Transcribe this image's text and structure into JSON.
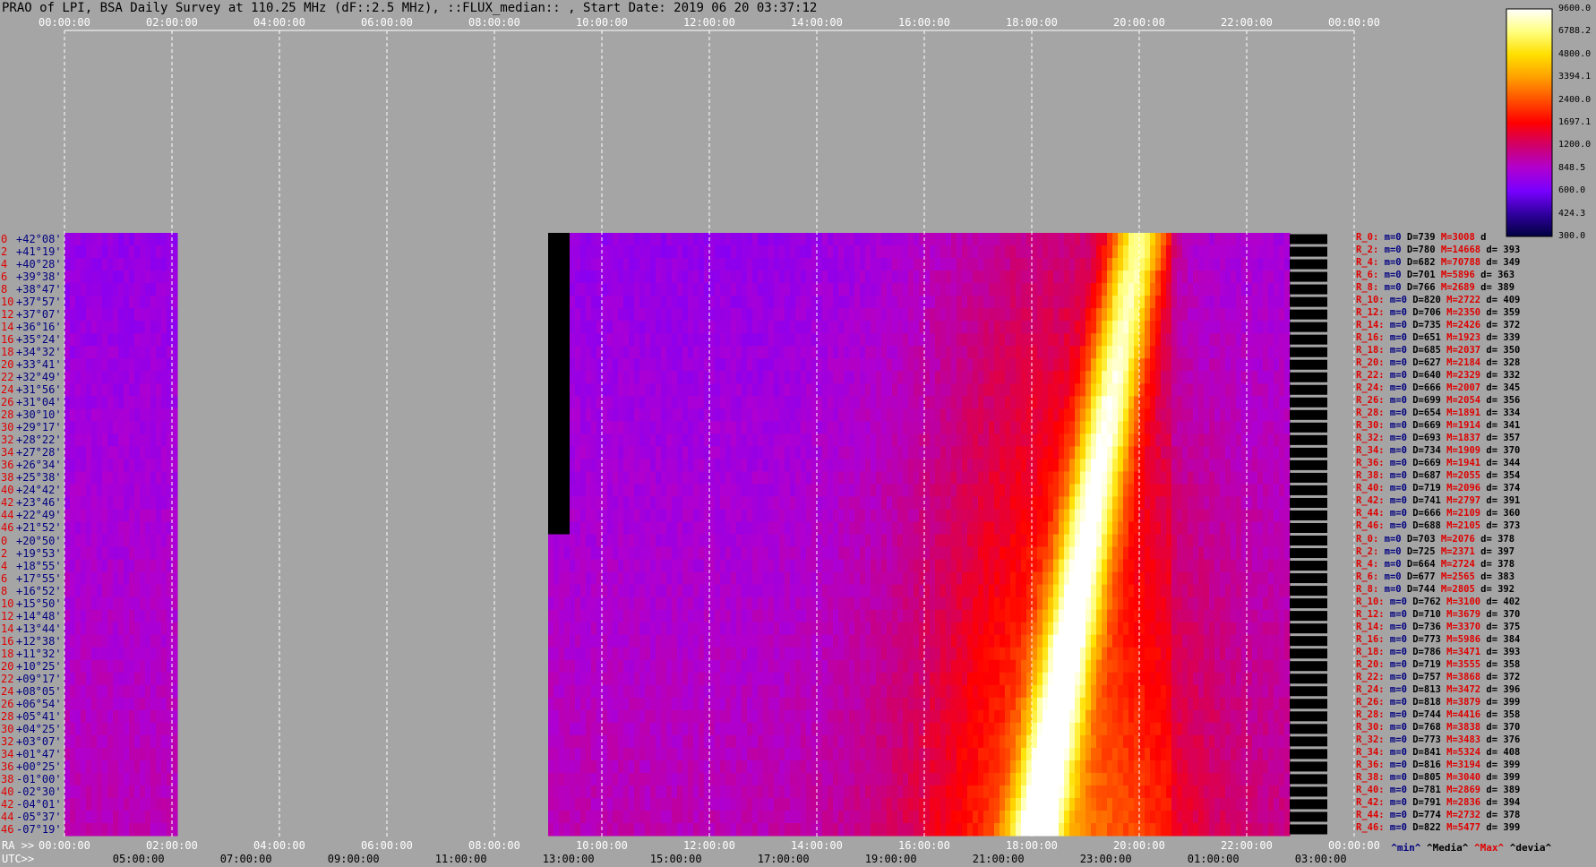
{
  "title": "PRAO of LPI, BSA Daily Survey at 110.25 MHz (dF::2.5 MHz), ::FLUX_median:: , Start Date: 2019 06 20 03:37:12",
  "top_ticks": [
    "00:00:00",
    "02:00:00",
    "04:00:00",
    "06:00:00",
    "08:00:00",
    "10:00:00",
    "12:00:00",
    "14:00:00",
    "16:00:00",
    "18:00:00",
    "20:00:00",
    "22:00:00",
    "00:00:00"
  ],
  "ra_label": "RA >>",
  "ra_ticks": [
    "00:00:00",
    "02:00:00",
    "04:00:00",
    "06:00:00",
    "08:00:00",
    "10:00:00",
    "12:00:00",
    "14:00:00",
    "16:00:00",
    "18:00:00",
    "20:00:00",
    "22:00:00",
    "00:00:00"
  ],
  "utc_label": "UTC>>",
  "utc_ticks": [
    "05:00:00",
    "07:00:00",
    "09:00:00",
    "11:00:00",
    "13:00:00",
    "15:00:00",
    "17:00:00",
    "19:00:00",
    "21:00:00",
    "23:00:00",
    "01:00:00",
    "03:00:00"
  ],
  "colorbar": {
    "labels": [
      "9600.0",
      "6788.2",
      "4800.0",
      "3394.1",
      "2400.0",
      "1697.1",
      "1200.0",
      "848.5",
      "600.0",
      "424.3",
      "300.0"
    ],
    "colors": [
      "#ffffff",
      "#ffff60",
      "#ffd000",
      "#ff8000",
      "#ff2000",
      "#e00000",
      "#c000a0",
      "#9000ff",
      "#5000c0",
      "#000050"
    ]
  },
  "legend_footer": {
    "min": "^min^",
    "median": "^Media^",
    "max": "^Max^",
    "dev": "^devia^"
  },
  "chart_data": {
    "type": "heatmap",
    "title": "PRAO of LPI, BSA Daily Survey at 110.25 MHz (dF::2.5 MHz), ::FLUX_median:: , Start Date: 2019 06 20 03:37:12",
    "x_axis": "RA 00:00:00 – 24:00:00 (UTC from 03:37:12)",
    "declinations": [
      "+42°08'",
      "+41°19'",
      "+40°28'",
      "+39°38'",
      "+38°47'",
      "+37°57'",
      "+37°07'",
      "+36°16'",
      "+35°24'",
      "+34°32'",
      "+33°41'",
      "+32°49'",
      "+31°56'",
      "+31°04'",
      "+30°10'",
      "+29°17'",
      "+28°22'",
      "+27°28'",
      "+26°34'",
      "+25°38'",
      "+24°42'",
      "+23°46'",
      "+22°49'",
      "+21°52'",
      "+20°50'",
      "+19°53'",
      "+18°55'",
      "+17°55'",
      "+16°52'",
      "+15°50'",
      "+14°48'",
      "+13°44'",
      "+12°38'",
      "+11°32'",
      "+10°25'",
      "+09°17'",
      "+08°05'",
      "+06°54'",
      "+05°41'",
      "+04°25'",
      "+03°07'",
      "+01°47'",
      "+00°25'",
      "-01°00'",
      "-02°30'",
      "-04°01'",
      "-05°37'",
      "-07°19'"
    ],
    "row_indices": [
      "0",
      "2",
      "4",
      "6",
      "8",
      "10",
      "12",
      "14",
      "16",
      "18",
      "20",
      "22",
      "24",
      "26",
      "28",
      "30",
      "32",
      "34",
      "36",
      "38",
      "40",
      "42",
      "44",
      "46",
      "0",
      "2",
      "4",
      "6",
      "8",
      "10",
      "12",
      "14",
      "16",
      "18",
      "20",
      "22",
      "24",
      "26",
      "28",
      "30",
      "32",
      "34",
      "36",
      "38",
      "40",
      "42",
      "44",
      "46"
    ],
    "data_segments_ra_hours": [
      [
        0.0,
        2.1
      ],
      [
        9.0,
        22.8
      ]
    ],
    "colorbar_scale": "log",
    "colorbar_range": [
      300.0,
      9600.0
    ],
    "stats": [
      {
        "name": "R_0:",
        "min": "m=0",
        "med": "D=739",
        "max": "M=3008",
        "dev": "d"
      },
      {
        "name": "R_2:",
        "min": "m=0",
        "med": "D=780",
        "max": "M=14668",
        "dev": "d= 393"
      },
      {
        "name": "R_4:",
        "min": "m=0",
        "med": "D=682",
        "max": "M=70788",
        "dev": "d= 349"
      },
      {
        "name": "R_6:",
        "min": "m=0",
        "med": "D=701",
        "max": "M=5896",
        "dev": "d= 363"
      },
      {
        "name": "R_8:",
        "min": "m=0",
        "med": "D=766",
        "max": "M=2689",
        "dev": "d= 389"
      },
      {
        "name": "R_10:",
        "min": "m=0",
        "med": "D=820",
        "max": "M=2722",
        "dev": "d= 409"
      },
      {
        "name": "R_12:",
        "min": "m=0",
        "med": "D=706",
        "max": "M=2350",
        "dev": "d= 359"
      },
      {
        "name": "R_14:",
        "min": "m=0",
        "med": "D=735",
        "max": "M=2426",
        "dev": "d= 372"
      },
      {
        "name": "R_16:",
        "min": "m=0",
        "med": "D=651",
        "max": "M=1923",
        "dev": "d= 339"
      },
      {
        "name": "R_18:",
        "min": "m=0",
        "med": "D=685",
        "max": "M=2037",
        "dev": "d= 350"
      },
      {
        "name": "R_20:",
        "min": "m=0",
        "med": "D=627",
        "max": "M=2184",
        "dev": "d= 328"
      },
      {
        "name": "R_22:",
        "min": "m=0",
        "med": "D=640",
        "max": "M=2329",
        "dev": "d= 332"
      },
      {
        "name": "R_24:",
        "min": "m=0",
        "med": "D=666",
        "max": "M=2007",
        "dev": "d= 345"
      },
      {
        "name": "R_26:",
        "min": "m=0",
        "med": "D=699",
        "max": "M=2054",
        "dev": "d= 356"
      },
      {
        "name": "R_28:",
        "min": "m=0",
        "med": "D=654",
        "max": "M=1891",
        "dev": "d= 334"
      },
      {
        "name": "R_30:",
        "min": "m=0",
        "med": "D=669",
        "max": "M=1914",
        "dev": "d= 341"
      },
      {
        "name": "R_32:",
        "min": "m=0",
        "med": "D=693",
        "max": "M=1837",
        "dev": "d= 357"
      },
      {
        "name": "R_34:",
        "min": "m=0",
        "med": "D=734",
        "max": "M=1909",
        "dev": "d= 370"
      },
      {
        "name": "R_36:",
        "min": "m=0",
        "med": "D=669",
        "max": "M=1941",
        "dev": "d= 344"
      },
      {
        "name": "R_38:",
        "min": "m=0",
        "med": "D=687",
        "max": "M=2055",
        "dev": "d= 354"
      },
      {
        "name": "R_40:",
        "min": "m=0",
        "med": "D=719",
        "max": "M=2096",
        "dev": "d= 374"
      },
      {
        "name": "R_42:",
        "min": "m=0",
        "med": "D=741",
        "max": "M=2797",
        "dev": "d= 391"
      },
      {
        "name": "R_44:",
        "min": "m=0",
        "med": "D=666",
        "max": "M=2109",
        "dev": "d= 360"
      },
      {
        "name": "R_46:",
        "min": "m=0",
        "med": "D=688",
        "max": "M=2105",
        "dev": "d= 373"
      },
      {
        "name": "R_0:",
        "min": "m=0",
        "med": "D=703",
        "max": "M=2076",
        "dev": "d= 378"
      },
      {
        "name": "R_2:",
        "min": "m=0",
        "med": "D=725",
        "max": "M=2371",
        "dev": "d= 397"
      },
      {
        "name": "R_4:",
        "min": "m=0",
        "med": "D=664",
        "max": "M=2724",
        "dev": "d= 378"
      },
      {
        "name": "R_6:",
        "min": "m=0",
        "med": "D=677",
        "max": "M=2565",
        "dev": "d= 383"
      },
      {
        "name": "R_8:",
        "min": "m=0",
        "med": "D=744",
        "max": "M=2805",
        "dev": "d= 392"
      },
      {
        "name": "R_10:",
        "min": "m=0",
        "med": "D=762",
        "max": "M=3100",
        "dev": "d= 402"
      },
      {
        "name": "R_12:",
        "min": "m=0",
        "med": "D=710",
        "max": "M=3679",
        "dev": "d= 370"
      },
      {
        "name": "R_14:",
        "min": "m=0",
        "med": "D=736",
        "max": "M=3370",
        "dev": "d= 375"
      },
      {
        "name": "R_16:",
        "min": "m=0",
        "med": "D=773",
        "max": "M=5986",
        "dev": "d= 384"
      },
      {
        "name": "R_18:",
        "min": "m=0",
        "med": "D=786",
        "max": "M=3471",
        "dev": "d= 393"
      },
      {
        "name": "R_20:",
        "min": "m=0",
        "med": "D=719",
        "max": "M=3555",
        "dev": "d= 358"
      },
      {
        "name": "R_22:",
        "min": "m=0",
        "med": "D=757",
        "max": "M=3868",
        "dev": "d= 372"
      },
      {
        "name": "R_24:",
        "min": "m=0",
        "med": "D=813",
        "max": "M=3472",
        "dev": "d= 396"
      },
      {
        "name": "R_26:",
        "min": "m=0",
        "med": "D=818",
        "max": "M=3879",
        "dev": "d= 399"
      },
      {
        "name": "R_28:",
        "min": "m=0",
        "med": "D=744",
        "max": "M=4416",
        "dev": "d= 358"
      },
      {
        "name": "R_30:",
        "min": "m=0",
        "med": "D=768",
        "max": "M=3838",
        "dev": "d= 370"
      },
      {
        "name": "R_32:",
        "min": "m=0",
        "med": "D=773",
        "max": "M=3483",
        "dev": "d= 376"
      },
      {
        "name": "R_34:",
        "min": "m=0",
        "med": "D=841",
        "max": "M=5324",
        "dev": "d= 408"
      },
      {
        "name": "R_36:",
        "min": "m=0",
        "med": "D=816",
        "max": "M=3194",
        "dev": "d= 399"
      },
      {
        "name": "R_38:",
        "min": "m=0",
        "med": "D=805",
        "max": "M=3040",
        "dev": "d= 399"
      },
      {
        "name": "R_40:",
        "min": "m=0",
        "med": "D=781",
        "max": "M=2869",
        "dev": "d= 389"
      },
      {
        "name": "R_42:",
        "min": "m=0",
        "med": "D=791",
        "max": "M=2836",
        "dev": "d= 394"
      },
      {
        "name": "R_44:",
        "min": "m=0",
        "med": "D=774",
        "max": "M=2732",
        "dev": "d= 378"
      },
      {
        "name": "R_46:",
        "min": "m=0",
        "med": "D=822",
        "max": "M=5477",
        "dev": "d= 399"
      }
    ]
  }
}
